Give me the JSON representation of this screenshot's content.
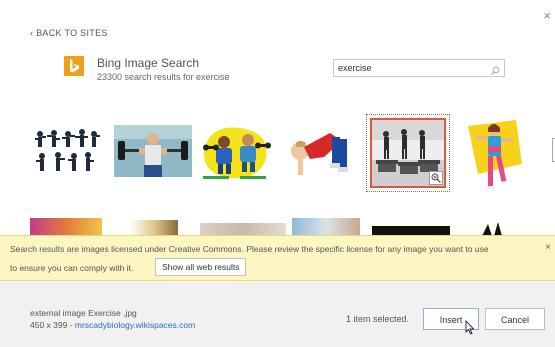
{
  "dialog": {
    "close_glyph": "×",
    "back_label": "‹ BACK TO SITES"
  },
  "source": {
    "icon": "bing-logo-icon",
    "title": "Bing Image Search",
    "results_text": "23300 search results for exercise"
  },
  "search": {
    "value": "exercise",
    "icon": "search-icon"
  },
  "results": [
    {
      "name": "dancers-silhouettes",
      "selected": false
    },
    {
      "name": "weightlifter",
      "selected": false
    },
    {
      "name": "cartoon-dumbbells",
      "selected": false
    },
    {
      "name": "child-stretching",
      "selected": false
    },
    {
      "name": "treadmill-runners",
      "selected": true
    },
    {
      "name": "aerobics-woman",
      "selected": false
    }
  ],
  "notice": {
    "line1": "Search results are images licensed under Creative Commons. Please review the specific license for any image you want to use",
    "line2": "to ensure you can comply with it.",
    "show_all_label": "Show all web results",
    "close_glyph": "×"
  },
  "footer": {
    "meta_line1": "external image   Exercise  .jpg",
    "meta_dims": "450 x 399 - ",
    "meta_site": "mrscadybiology.wikispaces.com",
    "selected_text": "1 item selected.",
    "insert_label": "Insert",
    "cancel_label": "Cancel"
  },
  "colors": {
    "bing_orange": "#f2a01a",
    "notice_bg": "#fdf5c2",
    "selected_border": "#e0563a",
    "link": "#2a6ebb"
  }
}
